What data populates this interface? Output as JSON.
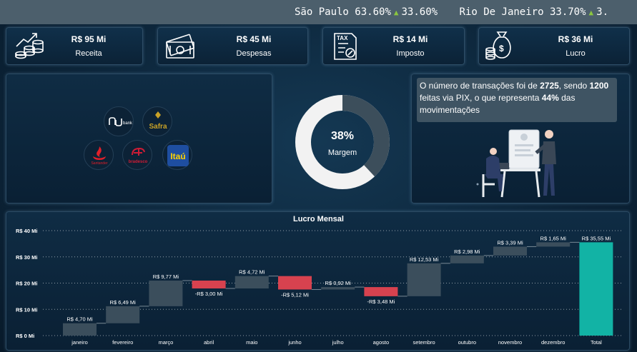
{
  "ticker": [
    {
      "city": "São Paulo",
      "pct1": "63.60%",
      "pct2": "33.60%"
    },
    {
      "city": "Rio De Janeiro",
      "pct1": "33.70%",
      "pct2": "3."
    }
  ],
  "kpis": [
    {
      "value": "R$ 95 Mi",
      "label": "Receita",
      "icon": "coins-growth-icon"
    },
    {
      "value": "R$ 45 Mi",
      "label": "Despesas",
      "icon": "cash-bills-icon"
    },
    {
      "value": "R$ 14 Mi",
      "label": "Imposto",
      "icon": "tax-document-icon"
    },
    {
      "value": "R$ 36 Mi",
      "label": "Lucro",
      "icon": "money-bag-icon"
    }
  ],
  "banks": [
    {
      "name": "nubank",
      "text": "bank",
      "color": "#ffffff"
    },
    {
      "name": "safra",
      "text": "Safra",
      "color": "#c9a227"
    },
    {
      "name": "santander",
      "text": "Santander",
      "color": "#e0202a"
    },
    {
      "name": "bradesco",
      "text": "bradesco",
      "color": "#d01c35"
    },
    {
      "name": "itau",
      "text": "Itaú",
      "color": "#1e4ea0"
    }
  ],
  "margin": {
    "value": 38,
    "pct_label": "38%",
    "label": "Margem"
  },
  "info": {
    "p1": "O número de transações foi de ",
    "n1": "2725",
    "p2": ", sendo ",
    "n2": "1200",
    "p3": " feitas via PIX, o que representa ",
    "n3": "44%",
    "p4": " das movimentações"
  },
  "colors": {
    "increase": "#3b4e5c",
    "decrease": "#d7424f",
    "total": "#12b3a5"
  },
  "chart_data": {
    "type": "waterfall",
    "title": "Lucro Mensal",
    "ylim": [
      0,
      40
    ],
    "yticks": [
      "R$ 0 Mi",
      "R$ 10 Mi",
      "R$ 20 Mi",
      "R$ 30 Mi",
      "R$ 40 Mi"
    ],
    "categories": [
      "janeiro",
      "fevereiro",
      "março",
      "abril",
      "maio",
      "junho",
      "julho",
      "agosto",
      "setembro",
      "outubro",
      "novembro",
      "dezembro",
      "Total"
    ],
    "values": [
      4.7,
      6.49,
      9.77,
      -3.0,
      4.72,
      -5.12,
      0.92,
      -3.48,
      12.53,
      2.98,
      3.39,
      1.65,
      35.55
    ],
    "labels": [
      "R$ 4,70 Mi",
      "R$ 6,49 Mi",
      "R$ 9,77 Mi",
      "-R$ 3,00 Mi",
      "R$ 4,72 Mi",
      "-R$ 5,12 Mi",
      "R$ 0,92 Mi",
      "-R$ 3,48 Mi",
      "R$ 12,53 Mi",
      "R$ 2,98 Mi",
      "R$ 3,39 Mi",
      "R$ 1,65 Mi",
      "R$ 35,55 Mi"
    ],
    "grid": true
  }
}
